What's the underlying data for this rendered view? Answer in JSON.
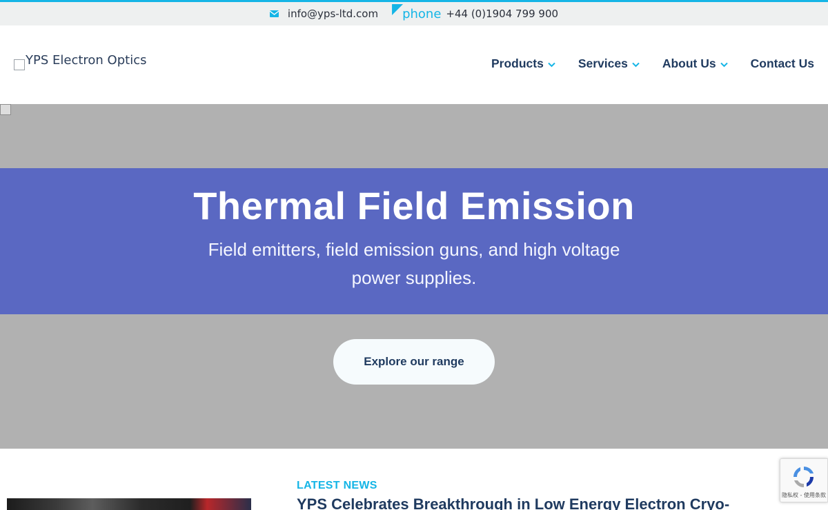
{
  "topbar": {
    "email": "info@yps-ltd.com",
    "phone_icon_alt": "phone",
    "phone": "+44 (0)1904 799 900",
    "accent_color": "#15b5e6"
  },
  "header": {
    "logo_alt": "YPS Electron Optics",
    "nav": [
      {
        "label": "Products",
        "has_dropdown": true
      },
      {
        "label": "Services",
        "has_dropdown": true
      },
      {
        "label": "About Us",
        "has_dropdown": true
      },
      {
        "label": "Contact Us",
        "has_dropdown": false
      }
    ]
  },
  "hero": {
    "title": "Thermal Field Emission",
    "subtitle": "Field emitters, field emission guns, and high voltage power supplies.",
    "cta_label": "Explore our range",
    "band_color": "#5a68c2"
  },
  "news": {
    "label": "LATEST NEWS",
    "title": "YPS Celebrates Breakthrough in Low Energy Electron Cryo-"
  },
  "recaptcha": {
    "terms": "隐私权 - 使用条款"
  }
}
